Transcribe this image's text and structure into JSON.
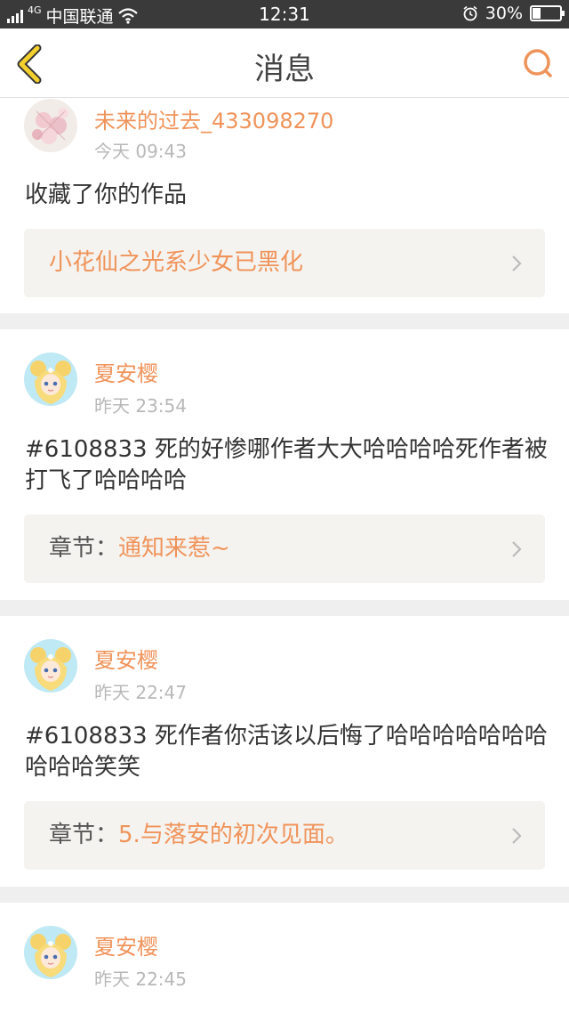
{
  "status_bar": {
    "network": "4G",
    "carrier": "中国联通",
    "time": "12:31",
    "battery": "30%",
    "battery_level": 0.3
  },
  "header": {
    "title": "消息"
  },
  "messages": [
    {
      "user": "未来的过去_433098270",
      "time": "今天 09:43",
      "text": "收藏了你的作品",
      "ref_prefix": "",
      "ref_title": "小花仙之光系少女已黑化"
    },
    {
      "user": "夏安樱",
      "time": "昨天 23:54",
      "text": "#6108833 死的好惨哪作者大大哈哈哈哈死作者被打飞了哈哈哈哈",
      "ref_prefix": "章节：",
      "ref_title": "通知来惹~"
    },
    {
      "user": "夏安樱",
      "time": "昨天 22:47",
      "text": "#6108833 死作者你活该以后悔了哈哈哈哈哈哈哈哈哈哈笑笑",
      "ref_prefix": "章节：",
      "ref_title": "5.与落安的初次见面。"
    },
    {
      "user": "夏安樱",
      "time": "昨天 22:45",
      "text": "",
      "ref_prefix": "",
      "ref_title": ""
    }
  ]
}
